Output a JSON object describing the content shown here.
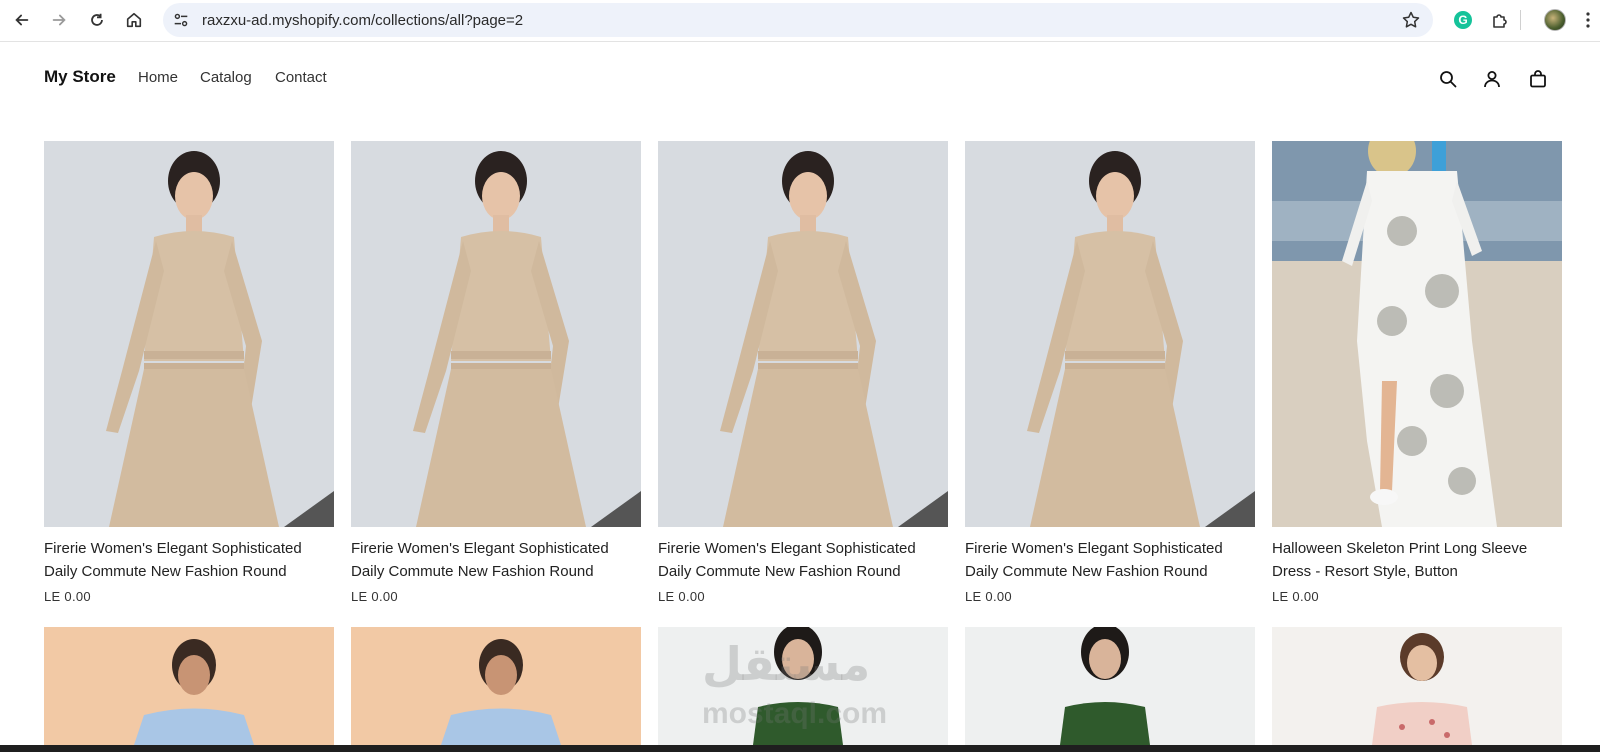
{
  "browser": {
    "url": "raxzxu-ad.myshopify.com/collections/all?page=2",
    "icons": [
      "back-arrow-icon",
      "forward-arrow-icon",
      "reload-icon",
      "home-icon",
      "site-settings-icon",
      "bookmark-star-icon",
      "grammarly-icon",
      "extensions-puzzle-icon",
      "profile-avatar",
      "more-menu-icon"
    ],
    "grammarly_letter": "G"
  },
  "store": {
    "name": "My Store",
    "nav": [
      "Home",
      "Catalog",
      "Contact"
    ],
    "header_icons": [
      "search-icon",
      "account-icon",
      "cart-icon"
    ]
  },
  "products_row1": [
    {
      "title": "Firerie Women's Elegant Sophisticated Daily Commute New Fashion Round",
      "price": "LE 0.00",
      "image": "beige-dress"
    },
    {
      "title": "Firerie Women's Elegant Sophisticated Daily Commute New Fashion Round",
      "price": "LE 0.00",
      "image": "beige-dress"
    },
    {
      "title": "Firerie Women's Elegant Sophisticated Daily Commute New Fashion Round",
      "price": "LE 0.00",
      "image": "beige-dress"
    },
    {
      "title": "Firerie Women's Elegant Sophisticated Daily Commute New Fashion Round",
      "price": "LE 0.00",
      "image": "beige-dress"
    },
    {
      "title": "Halloween Skeleton Print Long Sleeve Dress - Resort Style, Button",
      "price": "LE 0.00",
      "image": "skull-print-dress"
    }
  ],
  "products_row2": [
    {
      "image": "light-blue-floral-top"
    },
    {
      "image": "light-blue-floral-top"
    },
    {
      "image": "green-cami-dress"
    },
    {
      "image": "green-cami-dress"
    },
    {
      "image": "pink-floral-dress"
    }
  ],
  "watermark": {
    "arabic": "مستقل",
    "latin": "mostaql.com"
  },
  "colors": {
    "omnibox": "#eef2fa",
    "text": "#121212",
    "beige": "#d8c2a6",
    "peach": "#f3c9a4"
  }
}
